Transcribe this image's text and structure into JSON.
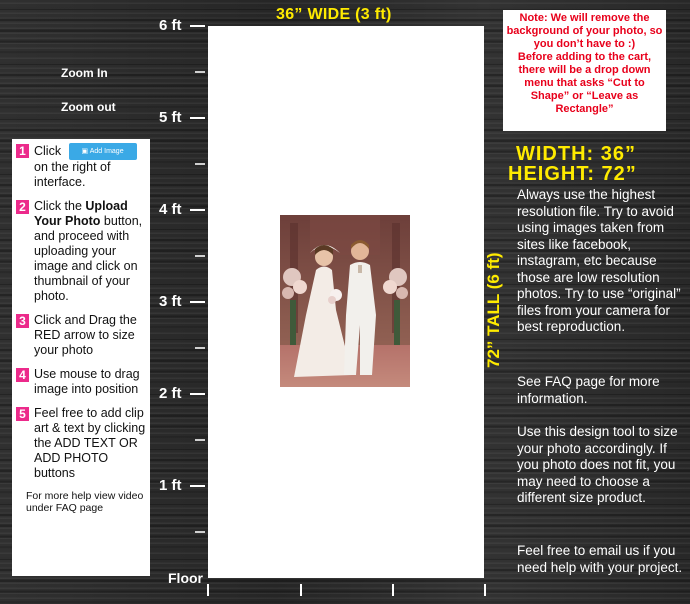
{
  "ruler": {
    "labels": [
      "6 ft",
      "5 ft",
      "4 ft",
      "3 ft",
      "2 ft",
      "1 ft"
    ],
    "floor": "Floor"
  },
  "zoom": {
    "zoom_in": "Zoom In",
    "zoom_out": "Zoom out"
  },
  "header": {
    "width_title": "36” WIDE (3 ft)",
    "height_title": "72” TALL (6 ft)"
  },
  "note": {
    "line1": "Note: We will remove the background of your photo, so you don’t have to :)",
    "line2": "Before adding to the cart, there will be a drop down menu that asks “Cut to Shape” or “Leave as Rectangle”"
  },
  "dimensions": {
    "width": "WIDTH: 36”",
    "height": "HEIGHT: 72”"
  },
  "info": {
    "p1": "Always use the highest resolution file. Try to avoid using images taken from sites like facebook, instagram, etc because those are low resolution photos. Try to use “original” files from your camera for best reproduction.",
    "p2": "See FAQ page for more information.",
    "p3": "Use this design tool to size your photo accordingly.  If you photo does not fit, you may need to choose a different size product.",
    "p4": "Feel free to email us if you need help with your project."
  },
  "instructions": {
    "step1_num": "1",
    "step1_a": "Click",
    "step1_button": "Add Image",
    "step1_b": "on the right of interface.",
    "step2_num": "2",
    "step2_a": "Click the ",
    "step2_bold": "Upload Your Photo",
    "step2_b": " button, and proceed with uploading your image and click on thumbnail of your photo.",
    "step3_num": "3",
    "step3": "Click and Drag the RED arrow to size your photo",
    "step4_num": "4",
    "step4": "Use mouse to drag image into position",
    "step5_num": "5",
    "step5": "Feel free to add clip art & text by clicking the ADD TEXT OR ADD PHOTO buttons",
    "help": "For more help view video under FAQ page"
  }
}
